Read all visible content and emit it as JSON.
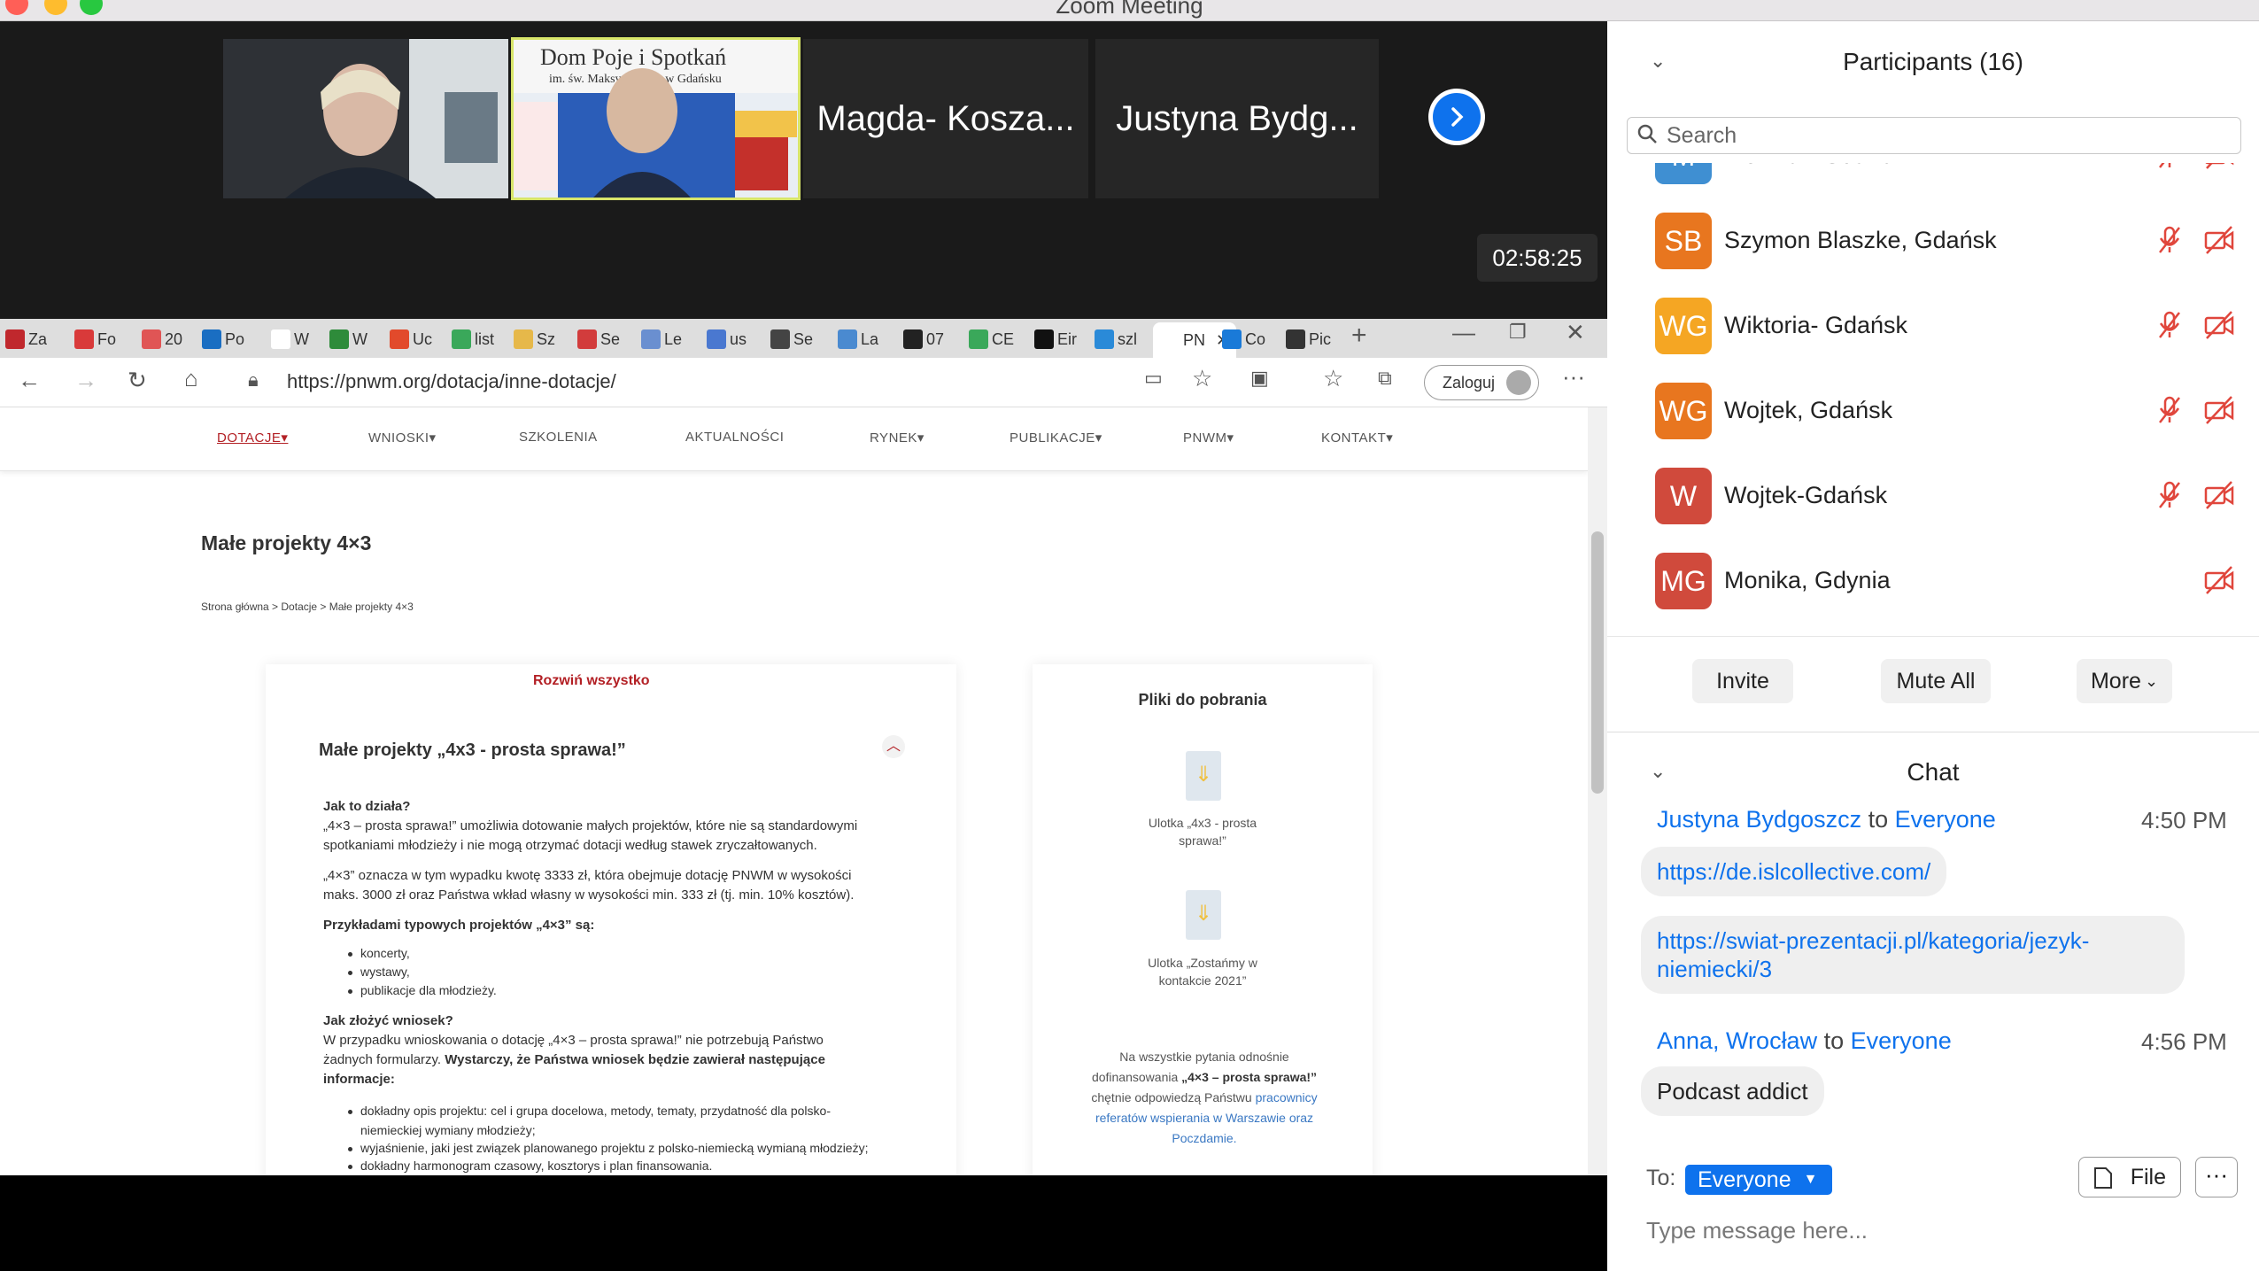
{
  "window": {
    "title": "Zoom Meeting"
  },
  "video": {
    "thumbnails": [
      {
        "name": "",
        "type": "video"
      },
      {
        "name": "",
        "type": "video-active"
      },
      {
        "name": "Magda- Kosza...",
        "type": "name"
      },
      {
        "name": "Justyna  Bydg...",
        "type": "name"
      }
    ],
    "timer": "02:58:25"
  },
  "browser": {
    "tabs": [
      {
        "label": "Za",
        "color": "#c0282d"
      },
      {
        "label": "Fo",
        "color": "#d93a3a"
      },
      {
        "label": "20",
        "color": "#e05555"
      },
      {
        "label": "Po",
        "color": "#1a6ec2"
      },
      {
        "label": "W",
        "color": "#ffffff"
      },
      {
        "label": "W",
        "color": "#2e8b3a"
      },
      {
        "label": "Uc",
        "color": "#e24a2b"
      },
      {
        "label": "list",
        "color": "#3aa85a"
      },
      {
        "label": "Sz",
        "color": "#e6b84a"
      },
      {
        "label": "Se",
        "color": "#d23c3c"
      },
      {
        "label": "Le",
        "color": "#6a8fd0"
      },
      {
        "label": "us",
        "color": "#4a78d0"
      },
      {
        "label": "Se",
        "color": "#444444"
      },
      {
        "label": "La",
        "color": "#4a8ad0"
      },
      {
        "label": "07",
        "color": "#222222"
      },
      {
        "label": "CE",
        "color": "#3aa85a"
      },
      {
        "label": "Eir",
        "color": "#111111"
      },
      {
        "label": "szl",
        "color": "#2a8ad8"
      },
      {
        "label": "PN",
        "color": "#ffffff",
        "active": true
      },
      {
        "label": "Co",
        "color": "#1a7ad8"
      },
      {
        "label": "Pic",
        "color": "#333333"
      }
    ],
    "url": "https://pnwm.org/dotacja/inne-dotacje/",
    "login_label": "Zaloguj"
  },
  "site": {
    "nav": [
      "DOTACJE",
      "WNIOSKI",
      "SZKOLENIA",
      "AKTUALNOŚCI",
      "RYNEK",
      "PUBLIKACJE",
      "PNWM",
      "KONTAKT"
    ],
    "title": "Małe projekty 4×3",
    "breadcrumb": "Strona główna > Dotacje > Małe projekty 4×3",
    "expand_all": "Rozwiń wszystko",
    "accordion_title": "Małe projekty „4x3 - prosta sprawa!”",
    "q1": "Jak to działa?",
    "p1a": "„4×3 – prosta sprawa!” umożliwia dotowanie małych projektów, które nie są standardowymi",
    "p1b": "spotkaniami młodzieży i nie mogą otrzymać dotacji według stawek zryczałtowanych.",
    "p2a": "„4×3” oznacza w tym wypadku kwotę 3333 zł, która obejmuje dotację PNWM w wysokości",
    "p2b": "maks. 3000 zł oraz Państwa wkład własny w wysokości min. 333 zł (tj. min. 10% kosztów).",
    "examples_head": "Przykładami typowych projektów „4×3” są:",
    "examples": [
      "koncerty,",
      "wystawy,",
      "publikacje dla młodzieży."
    ],
    "q2": "Jak złożyć wniosek?",
    "p3a": "W przypadku wnioskowania o dotację „4×3 – prosta sprawa!” nie potrzebują Państwo",
    "p3b_plain": "żadnych formularzy. ",
    "p3b_bold": "Wystarczy, że Państwa wniosek będzie zawierał następujące",
    "p3c_bold": "informacje:",
    "reqs": [
      "dokładny opis projektu: cel i grupa docelowa, metody, tematy, przydatność dla polsko-",
      "niemieckiej wymiany młodzieży;",
      "wyjaśnienie, jaki jest związek planowanego projektu z polsko-niemiecką wymianą młodzieży;",
      "dokładny harmonogram czasowy, kosztorys i plan finansowania."
    ],
    "files_title": "Pliki do pobrania",
    "file1a": "Ulotka „4x3 - prosta",
    "file1b": "sprawa!”",
    "file2a": "Ulotka „Zostańmy w",
    "file2b": "kontakcie 2021”",
    "contact1": "Na wszystkie pytania odnośnie",
    "contact2_plain": "dofinansowania ",
    "contact2_bold": "„4×3 – prosta sprawa!”",
    "contact3_plain": "chętnie odpowiedzą Państwu ",
    "contact3_link": "pracownicy",
    "contact4_link": "referatów wspierania w Warszawie oraz",
    "contact5_link": "Poczdamie."
  },
  "participants": {
    "title": "Participants (16)",
    "search_placeholder": "Search",
    "list": [
      {
        "initials": "M",
        "name": "Monika - Gdańsk",
        "color": "#3f8fd2",
        "muted": true,
        "video_off": true
      },
      {
        "initials": "SB",
        "name": "Szymon Blaszke, Gdańsk",
        "color": "#e8761f",
        "muted": true,
        "video_off": true
      },
      {
        "initials": "WG",
        "name": "Wiktoria- Gdańsk",
        "color": "#f5a623",
        "muted": true,
        "video_off": true
      },
      {
        "initials": "WG",
        "name": "Wojtek, Gdańsk",
        "color": "#e8761f",
        "muted": true,
        "video_off": true
      },
      {
        "initials": "W",
        "name": "Wojtek-Gdańsk",
        "color": "#d04a3c",
        "muted": true,
        "video_off": true
      },
      {
        "initials": "MG",
        "name": "Monika, Gdynia",
        "color": "#d04a3c",
        "muted": false,
        "video_off": true
      }
    ],
    "invite": "Invite",
    "mute_all": "Mute All",
    "more": "More"
  },
  "chat": {
    "title": "Chat",
    "to_word": "to",
    "messages": [
      {
        "sender": "Justyna  Bydgoszcz",
        "to": "Everyone",
        "time": "4:50 PM"
      },
      {
        "sender": "Anna, Wrocław",
        "to": "Everyone",
        "time": "4:56 PM"
      }
    ],
    "link1": "https://de.islcollective.com/",
    "link2a": "https://swiat-prezentacji.pl/kategoria/jezyk-",
    "link2b": "niemiecki/3",
    "text1": "Podcast addict",
    "to_label": "To:",
    "recipient": "Everyone",
    "file_label": "File",
    "more_label": "···",
    "input_placeholder": "Type message here..."
  },
  "colors": {
    "zoom_blue": "#0e72ed",
    "accent_red": "#b32025",
    "muted_red": "#e0463c"
  }
}
